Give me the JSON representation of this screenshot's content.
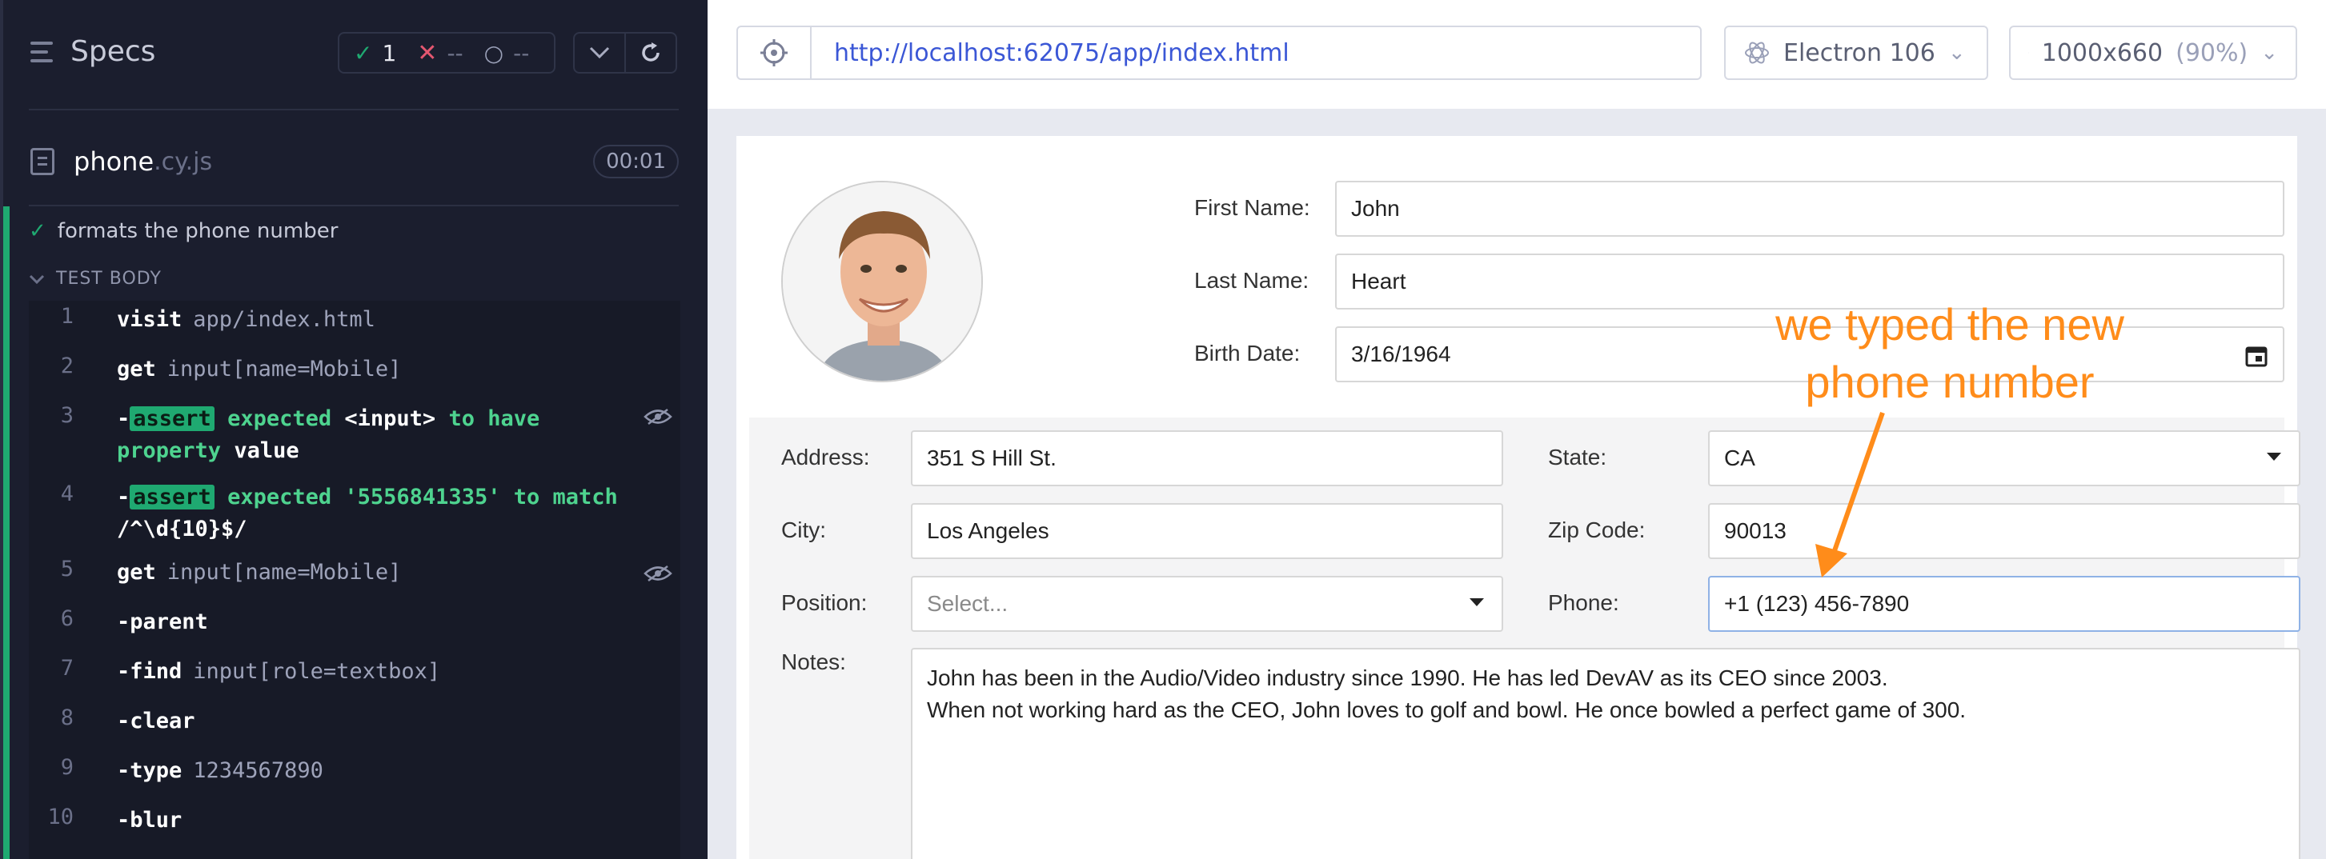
{
  "runner": {
    "title": "Specs",
    "stats": {
      "passed": "1",
      "failed": "--",
      "pending": "--"
    },
    "file": {
      "name": "phone",
      "ext": ".cy.js",
      "duration": "00:01"
    },
    "test": {
      "title": "formats the phone number",
      "body_label": "TEST BODY",
      "commands": [
        {
          "num": "1",
          "name": "visit",
          "arg": "app/index.html"
        },
        {
          "num": "2",
          "name": "get",
          "arg": "input[name=Mobile]"
        },
        {
          "num": "3",
          "badge": "assert",
          "text1": "expected",
          "subject": "<input>",
          "text2": "to have",
          "text3": "property",
          "value": "value"
        },
        {
          "num": "4",
          "badge": "assert",
          "text1": "expected",
          "subject": "'5556841335'",
          "text2": "to match",
          "value": "/^\\d{10}$/"
        },
        {
          "num": "5",
          "name": "get",
          "arg": "input[name=Mobile]"
        },
        {
          "num": "6",
          "name": "-parent",
          "arg": ""
        },
        {
          "num": "7",
          "name": "-find",
          "arg": "input[role=textbox]"
        },
        {
          "num": "8",
          "name": "-clear",
          "arg": ""
        },
        {
          "num": "9",
          "name": "-type",
          "arg": "1234567890"
        },
        {
          "num": "10",
          "name": "-blur",
          "arg": ""
        }
      ]
    }
  },
  "browser": {
    "url": "http://localhost:62075/app/index.html",
    "engine": "Electron 106",
    "viewport": "1000x660",
    "scale": "(90%)"
  },
  "form": {
    "first_name_label": "First Name:",
    "first_name": "John",
    "last_name_label": "Last Name:",
    "last_name": "Heart",
    "birth_label": "Birth Date:",
    "birth_date": "3/16/1964",
    "address_label": "Address:",
    "address": "351 S Hill St.",
    "state_label": "State:",
    "state": "CA",
    "city_label": "City:",
    "city": "Los Angeles",
    "zip_label": "Zip Code:",
    "zip": "90013",
    "position_label": "Position:",
    "position_placeholder": "Select...",
    "phone_label": "Phone:",
    "phone": "+1 (123) 456-7890",
    "notes_label": "Notes:",
    "notes_line1": "John has been in the Audio/Video industry since 1990. He has led DevAV as its CEO since 2003.",
    "notes_line2": "When not working hard as the CEO, John loves to golf and bowl. He once bowled a perfect game of 300."
  },
  "annotation": {
    "line1": "we typed the new",
    "line2": "phone number",
    "color": "#ff8c1a"
  },
  "colors": {
    "pass": "#1fa971",
    "fail": "#e45770",
    "url": "#3b57d6"
  }
}
